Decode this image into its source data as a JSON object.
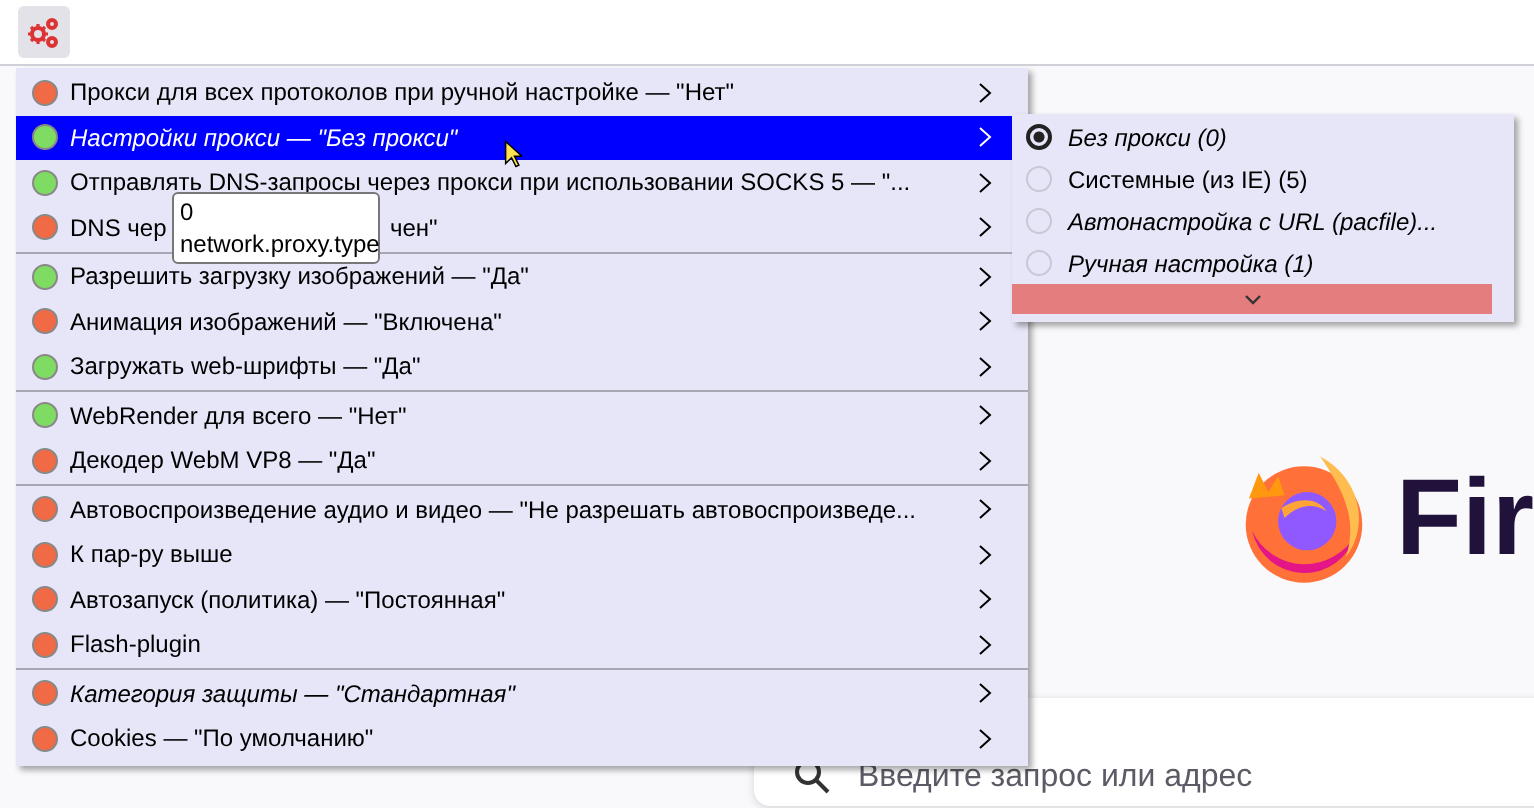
{
  "menu": {
    "groups": [
      [
        {
          "label": "Прокси для всех протоколов при ручной настройке — \"Нет\"",
          "color": "#f06a45",
          "italic": false,
          "selected": false
        },
        {
          "label": "Настройки прокси — \"Без прокси\"",
          "color": "#7fdc62",
          "italic": true,
          "selected": true
        },
        {
          "label": "Отправлять DNS-запросы через прокси при использовании SOCKS 5 — \"...",
          "color": "#7fdc62",
          "italic": false,
          "selected": false
        },
        {
          "label": "DNS чер",
          "label_end": "чен\"",
          "color": "#f06a45",
          "italic": false,
          "selected": false
        }
      ],
      [
        {
          "label": "Разрешить загрузку изображений — \"Да\"",
          "color": "#7fdc62",
          "italic": false,
          "selected": false
        },
        {
          "label": "Анимация изображений — \"Включена\"",
          "color": "#f06a45",
          "italic": false,
          "selected": false
        },
        {
          "label": "Загружать web-шрифты — \"Да\"",
          "color": "#7fdc62",
          "italic": false,
          "selected": false
        }
      ],
      [
        {
          "label": "WebRender для всего — \"Нет\"",
          "color": "#7fdc62",
          "italic": false,
          "selected": false
        },
        {
          "label": "Декодер WebM VP8 — \"Да\"",
          "color": "#f06a45",
          "italic": false,
          "selected": false
        }
      ],
      [
        {
          "label": "Автовоспроизведение аудио и видео — \"Не разрешать автовоспроизведе...",
          "color": "#f06a45",
          "italic": false,
          "selected": false
        },
        {
          "label": "К пар-ру выше",
          "color": "#f06a45",
          "italic": false,
          "selected": false
        },
        {
          "label": "Автозапуск (политика) — \"Постоянная\"",
          "color": "#f06a45",
          "italic": false,
          "selected": false
        },
        {
          "label": "Flash-plugin",
          "color": "#f06a45",
          "italic": false,
          "selected": false
        }
      ],
      [
        {
          "label": "Категория защиты — \"Стандартная\"",
          "color": "#f06a45",
          "italic": true,
          "selected": false
        },
        {
          "label": "Cookies — \"По умолчанию\"",
          "color": "#f06a45",
          "italic": false,
          "selected": false
        }
      ]
    ]
  },
  "submenu": {
    "items": [
      {
        "label": "Без прокси (0)",
        "italic": true,
        "selected": true
      },
      {
        "label": "Системные (из IE) (5)",
        "italic": false,
        "selected": false
      },
      {
        "label": "Автонастройка с URL (pacfile)...",
        "italic": true,
        "selected": false
      },
      {
        "label": "Ручная настройка (1)",
        "italic": true,
        "selected": false
      }
    ]
  },
  "tooltip": {
    "lines": [
      "0",
      "network.proxy.type"
    ]
  },
  "page": {
    "logo_text": "Fir",
    "search": {
      "placeholder": "Введите запрос или адрес"
    }
  }
}
